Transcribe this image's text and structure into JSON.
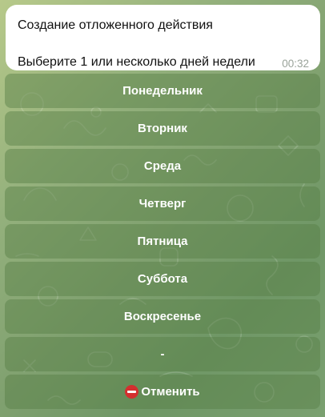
{
  "message": {
    "title": "Создание отложенного действия",
    "text": "Выберите 1 или несколько дней недели",
    "time": "00:32"
  },
  "keyboard": {
    "buttons": [
      {
        "label": "Понедельник"
      },
      {
        "label": "Вторник"
      },
      {
        "label": "Среда"
      },
      {
        "label": "Четверг"
      },
      {
        "label": "Пятница"
      },
      {
        "label": "Суббота"
      },
      {
        "label": "Воскресенье"
      },
      {
        "label": "-"
      },
      {
        "label": "Отменить",
        "icon": "no-entry-icon"
      }
    ]
  },
  "colors": {
    "bubble": "#ffffff",
    "button": "#6e9260",
    "cancel_icon": "#d32f2f"
  }
}
